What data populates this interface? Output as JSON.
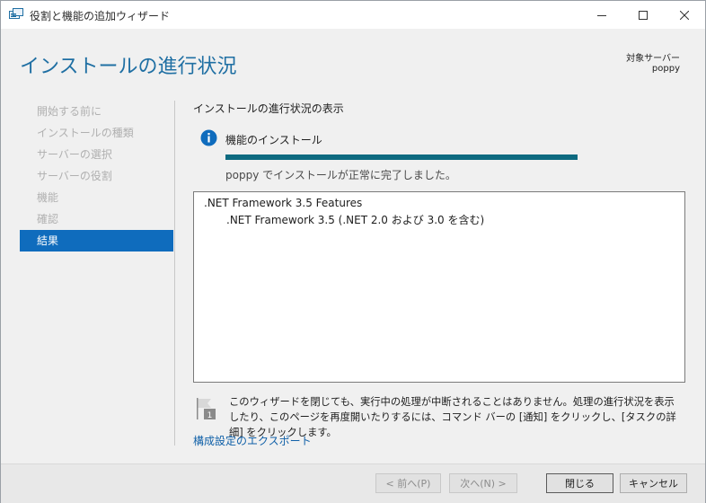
{
  "window": {
    "title": "役割と機能の追加ウィザード",
    "controls": {
      "minimize_icon": "minimize-icon",
      "maximize_icon": "maximize-icon",
      "close_icon": "close-icon"
    }
  },
  "header": {
    "page_title": "インストールの進行状況",
    "target_label": "対象サーバー",
    "target_value": "poppy"
  },
  "nav": {
    "items": [
      {
        "label": "開始する前に",
        "state": "disabled"
      },
      {
        "label": "インストールの種類",
        "state": "disabled"
      },
      {
        "label": "サーバーの選択",
        "state": "disabled"
      },
      {
        "label": "サーバーの役割",
        "state": "disabled"
      },
      {
        "label": "機能",
        "state": "disabled"
      },
      {
        "label": "確認",
        "state": "disabled"
      },
      {
        "label": "結果",
        "state": "active"
      }
    ]
  },
  "main": {
    "heading": "インストールの進行状況の表示",
    "status_title": "機能のインストール",
    "progress_percent": 100,
    "status_message": "poppy でインストールが正常に完了しました。",
    "results": [
      ".NET Framework 3.5 Features",
      ".NET Framework 3.5 (.NET 2.0 および 3.0 を含む)"
    ],
    "note_badge": "1",
    "note": "このウィザードを閉じても、実行中の処理が中断されることはありません。処理の進行状況を表示したり、このページを再度開いたりするには、コマンド バーの [通知] をクリックし、[タスクの詳細] をクリックします。",
    "export_link": "構成設定のエクスポート"
  },
  "footer": {
    "prev_label": "< 前へ(P)",
    "next_label": "次へ(N) >",
    "close_label": "閉じる",
    "cancel_label": "キャンセル"
  },
  "colors": {
    "accent": "#0f6cbd",
    "title": "#1f6fa3",
    "progress": "#0e6a80",
    "link": "#1060a8"
  }
}
